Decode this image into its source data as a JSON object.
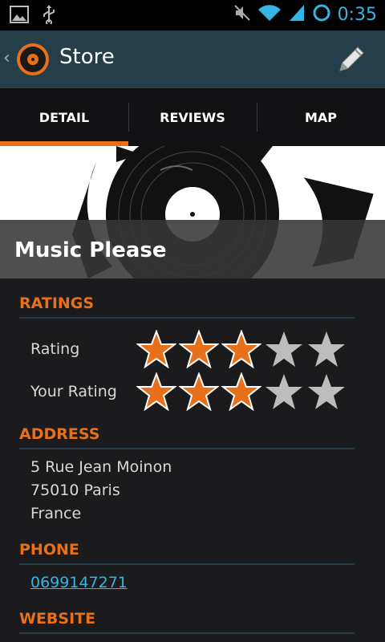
{
  "status_bar": {
    "time": "0:35",
    "icons": [
      "image-icon",
      "usb-icon",
      "mute-icon",
      "wifi-icon",
      "signal-icon",
      "sync-icon"
    ]
  },
  "action_bar": {
    "title": "Store",
    "icons": [
      "back-chevron-icon",
      "vinyl-logo-icon",
      "pencil-edit-icon"
    ]
  },
  "tabs": [
    {
      "label": "DETAIL",
      "active": true
    },
    {
      "label": "REVIEWS",
      "active": false
    },
    {
      "label": "MAP",
      "active": false
    }
  ],
  "hero": {
    "store_name": "Music Please"
  },
  "ratings": {
    "heading": "RATINGS",
    "rows": [
      {
        "label": "Rating",
        "stars_filled": 3,
        "stars_total": 5
      },
      {
        "label": "Your Rating",
        "stars_filled": 3,
        "stars_total": 5
      }
    ]
  },
  "address": {
    "heading": "ADDRESS",
    "lines": [
      "5 Rue Jean Moinon",
      "75010 Paris",
      "France"
    ]
  },
  "phone": {
    "heading": "PHONE",
    "number": "0699147271"
  },
  "website": {
    "heading": "WEBSITE"
  },
  "colors": {
    "accent": "#e8701b",
    "link": "#33b5e5",
    "actionbar": "#243f4a",
    "background": "#1b1b1d"
  }
}
